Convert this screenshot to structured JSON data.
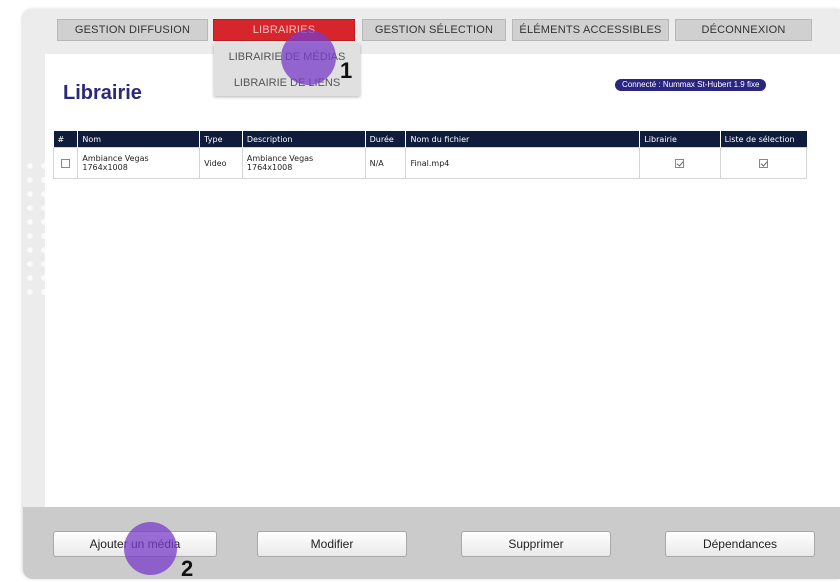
{
  "nav": {
    "tabs": [
      {
        "label": "GESTION DIFFUSION"
      },
      {
        "label": "LIBRAIRIES"
      },
      {
        "label": "GESTION SÉLECTION"
      },
      {
        "label": "ÉLÉMENTS ACCESSIBLES"
      },
      {
        "label": "DÉCONNEXION"
      }
    ],
    "active_tab": "LIBRAIRIES",
    "active_color": "#d7262b"
  },
  "dropdown": {
    "items": [
      {
        "label": "LIBRAIRIE DE MÉDIAS"
      },
      {
        "label": "LIBRAIRIE DE LIENS"
      }
    ]
  },
  "page": {
    "title": "Librairie",
    "connection_label": "Connecté : Nummax St-Hubert 1.9 fixe"
  },
  "table": {
    "headers": [
      "#",
      "Nom",
      "Type",
      "Description",
      "Durée",
      "Nom du fichier",
      "Librairie",
      "Liste de sélection"
    ],
    "rows": [
      {
        "nom_line1": "Ambiance Vegas",
        "nom_line2": "1764x1008",
        "type": "Video",
        "desc_line1": "Ambiance Vegas",
        "desc_line2": "1764x1008",
        "duree": "N/A",
        "fichier": "Final.mp4",
        "selected": false,
        "librairie": true,
        "liste_selection": true
      }
    ]
  },
  "footer": {
    "buttons": [
      {
        "label": "Ajouter un média"
      },
      {
        "label": "Modifier"
      },
      {
        "label": "Supprimer"
      },
      {
        "label": "Dépendances"
      }
    ]
  },
  "annotations": [
    {
      "number": "1"
    },
    {
      "number": "2"
    }
  ],
  "colors": {
    "title": "#2a2a78",
    "header_bg": "#0f1c3c",
    "badge_bg": "#2a2580",
    "marker": "#783cc8"
  }
}
